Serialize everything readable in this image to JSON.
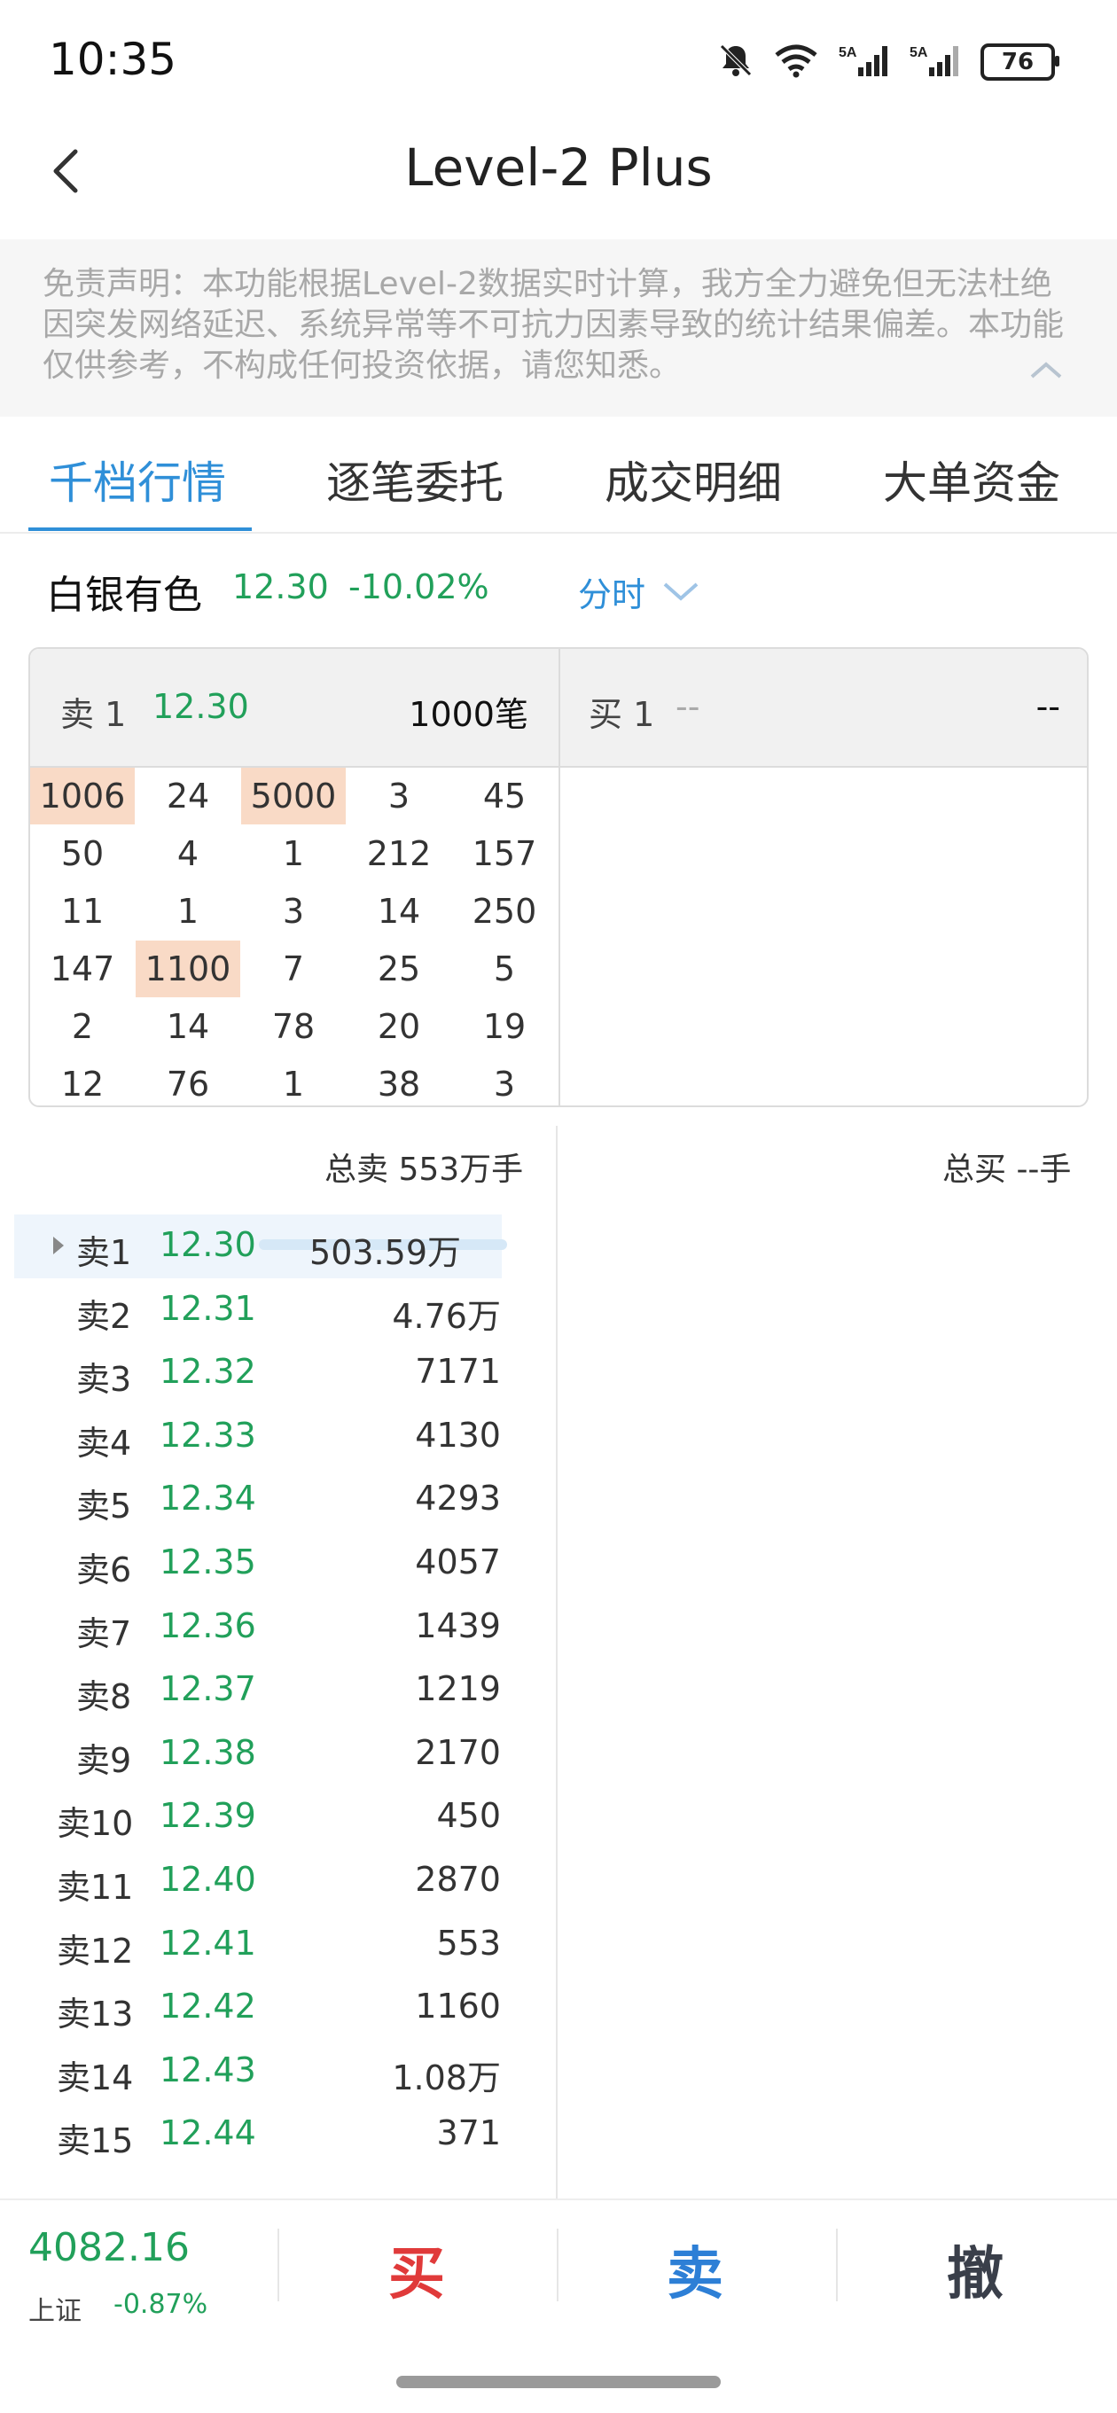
{
  "status_bar": {
    "time": "10:35",
    "battery": "76"
  },
  "header": {
    "title": "Level-2 Plus"
  },
  "disclaimer": {
    "text": "免责声明：本功能根据Level-2数据实时计算，我方全力避免但无法杜绝因突发网络延迟、系统异常等不可抗力因素导致的统计结果偏差。本功能仅供参考，不构成任何投资依据，请您知悉。"
  },
  "tabs": [
    "千档行情",
    "逐笔委托",
    "成交明细",
    "大单资金"
  ],
  "stock": {
    "name": "白银有色",
    "price": "12.30",
    "change": "-10.02%",
    "period": "分时"
  },
  "queue": {
    "sell_label": "卖 1",
    "sell_price": "12.30",
    "sell_count": "1000笔",
    "buy_label": "买 1",
    "buy_price": "--",
    "buy_count": "--",
    "cells": [
      [
        "1006",
        "24",
        "5000",
        "3",
        "45"
      ],
      [
        "50",
        "4",
        "1",
        "212",
        "157"
      ],
      [
        "11",
        "1",
        "3",
        "14",
        "250"
      ],
      [
        "147",
        "1100",
        "7",
        "25",
        "5"
      ],
      [
        "2",
        "14",
        "78",
        "20",
        "19"
      ],
      [
        "12",
        "76",
        "1",
        "38",
        "3"
      ]
    ]
  },
  "totals": {
    "sell": "总卖 553万手",
    "buy": "总买 --手"
  },
  "depth": [
    {
      "label": "卖1",
      "price": "12.30",
      "volume": "503.59万"
    },
    {
      "label": "卖2",
      "price": "12.31",
      "volume": "4.76万"
    },
    {
      "label": "卖3",
      "price": "12.32",
      "volume": "7171"
    },
    {
      "label": "卖4",
      "price": "12.33",
      "volume": "4130"
    },
    {
      "label": "卖5",
      "price": "12.34",
      "volume": "4293"
    },
    {
      "label": "卖6",
      "price": "12.35",
      "volume": "4057"
    },
    {
      "label": "卖7",
      "price": "12.36",
      "volume": "1439"
    },
    {
      "label": "卖8",
      "price": "12.37",
      "volume": "1219"
    },
    {
      "label": "卖9",
      "price": "12.38",
      "volume": "2170"
    },
    {
      "label": "卖10",
      "price": "12.39",
      "volume": "450"
    },
    {
      "label": "卖11",
      "price": "12.40",
      "volume": "2870"
    },
    {
      "label": "卖12",
      "price": "12.41",
      "volume": "553"
    },
    {
      "label": "卖13",
      "price": "12.42",
      "volume": "1160"
    },
    {
      "label": "卖14",
      "price": "12.43",
      "volume": "1.08万"
    },
    {
      "label": "卖15",
      "price": "12.44",
      "volume": "371"
    }
  ],
  "bottom": {
    "index_value": "4082.16",
    "index_name": "上证",
    "index_change": "-0.87%",
    "buy": "买",
    "sell": "卖",
    "cancel": "撤"
  },
  "colors": {
    "up": "#e03a3a",
    "down": "#21a05a",
    "accent": "#2f8fd8",
    "sell_button": "#2d7fd6",
    "cancel_button": "#3a3f4a"
  },
  "icons": [
    "mute-icon",
    "wifi-icon",
    "signal-icon",
    "battery-icon",
    "back-icon",
    "chevron-up-icon",
    "chevron-down-icon"
  ]
}
